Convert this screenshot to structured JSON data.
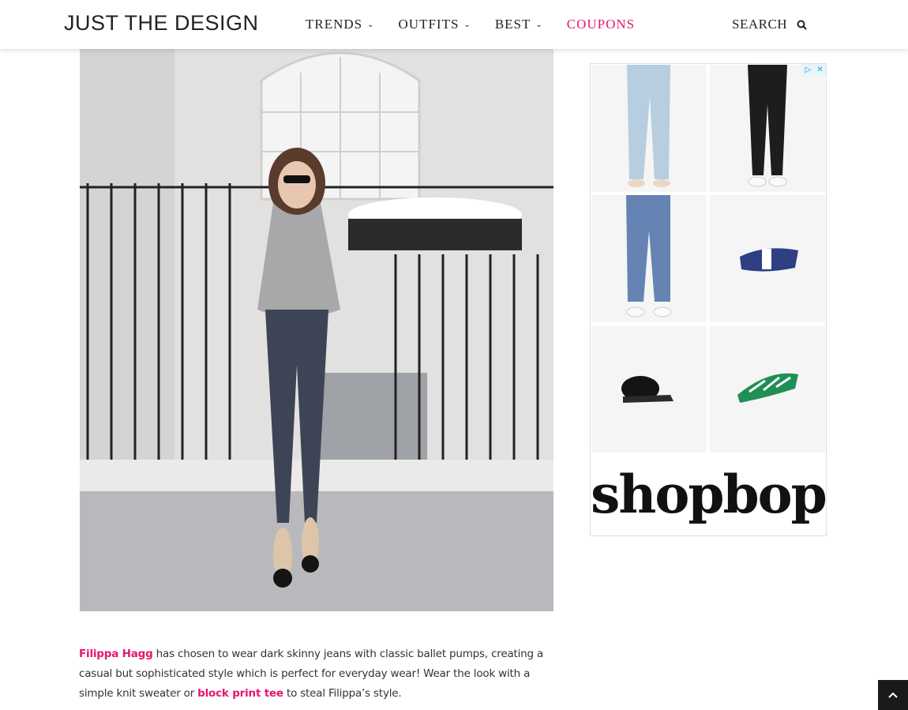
{
  "header": {
    "logo": "JUST THE DESIGN",
    "nav": [
      {
        "label": "TRENDS",
        "has_dropdown": true
      },
      {
        "label": "OUTFITS",
        "has_dropdown": true
      },
      {
        "label": "BEST",
        "has_dropdown": true
      },
      {
        "label": "COUPONS",
        "has_dropdown": false
      }
    ],
    "search_label": "SEARCH",
    "accent_color": "#e6166f"
  },
  "caption": {
    "link1": "Filippa Hagg",
    "text1": " has chosen to wear dark skinny jeans with classic ballet pumps, creating a casual but sophisticated style which is perfect for everyday wear! Wear the look with a simple knit sweater or ",
    "link2": "block print tee",
    "text2": " to steal Filippa’s style."
  },
  "ad": {
    "brand": "shopbop",
    "products": [
      "light-wash-jeans",
      "black-skinny-jeans",
      "cropped-jeans",
      "blue-white-slide",
      "fur-mule",
      "green-print-mule"
    ]
  }
}
